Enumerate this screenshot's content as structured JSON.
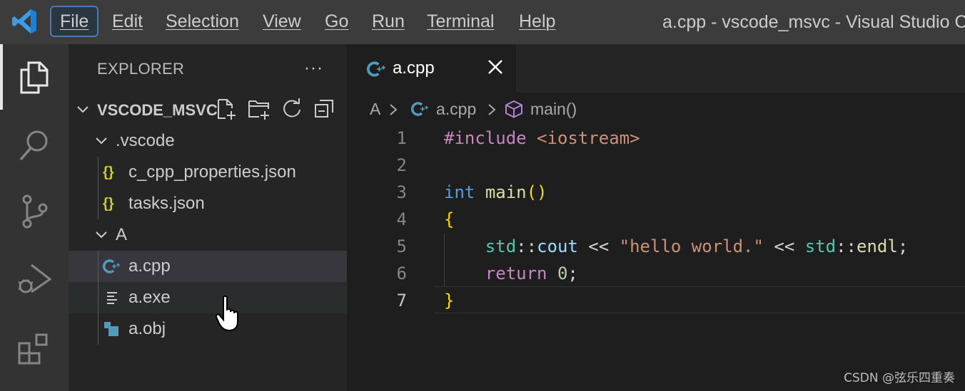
{
  "window_title": "a.cpp - vscode_msvc - Visual Studio Code",
  "menu": [
    "File",
    "Edit",
    "Selection",
    "View",
    "Go",
    "Run",
    "Terminal",
    "Help"
  ],
  "explorer": {
    "title": "EXPLORER",
    "more": "···",
    "folder": "VSCODE_MSVC",
    "tree": [
      {
        "label": ".vscode",
        "kind": "folder"
      },
      {
        "label": "c_cpp_properties.json",
        "kind": "json"
      },
      {
        "label": "tasks.json",
        "kind": "json"
      },
      {
        "label": "A",
        "kind": "folder"
      },
      {
        "label": "a.cpp",
        "kind": "cpp"
      },
      {
        "label": "a.exe",
        "kind": "exe"
      },
      {
        "label": "a.obj",
        "kind": "obj"
      }
    ],
    "json_glyph": "{}"
  },
  "tab": {
    "label": "a.cpp"
  },
  "breadcrumb": [
    "A",
    "a.cpp",
    "main()"
  ],
  "line_numbers": [
    "1",
    "2",
    "3",
    "4",
    "5",
    "6",
    "7"
  ],
  "code": {
    "l1_kw": "#include",
    "l1_inc": "<iostream>",
    "l3_type": "int",
    "l3_fn": "main",
    "l3_paren": "()",
    "l4_brace": "{",
    "l5_ns1": "std",
    "l5_sep1": "::",
    "l5_cout": "cout",
    "l5_op1": " << ",
    "l5_str": "\"hello world.\"",
    "l5_op2": " << ",
    "l5_ns2": "std",
    "l5_sep2": "::",
    "l5_endl": "endl",
    "l5_semi": ";",
    "l6_ret": "return",
    "l6_num": "0",
    "l6_semi": ";",
    "l7_brace": "}"
  },
  "watermark": "CSDN @弦乐四重奏",
  "colors": {
    "keyword_purple": "#c586c0",
    "include_string": "#ce9178",
    "type_blue": "#569cd6",
    "function_yellow": "#dcdcaa",
    "bracket_gold": "#ffd700",
    "namespace_teal": "#4ec9b0",
    "variable_blue": "#9cdcfe",
    "number_green": "#b5cea8"
  }
}
